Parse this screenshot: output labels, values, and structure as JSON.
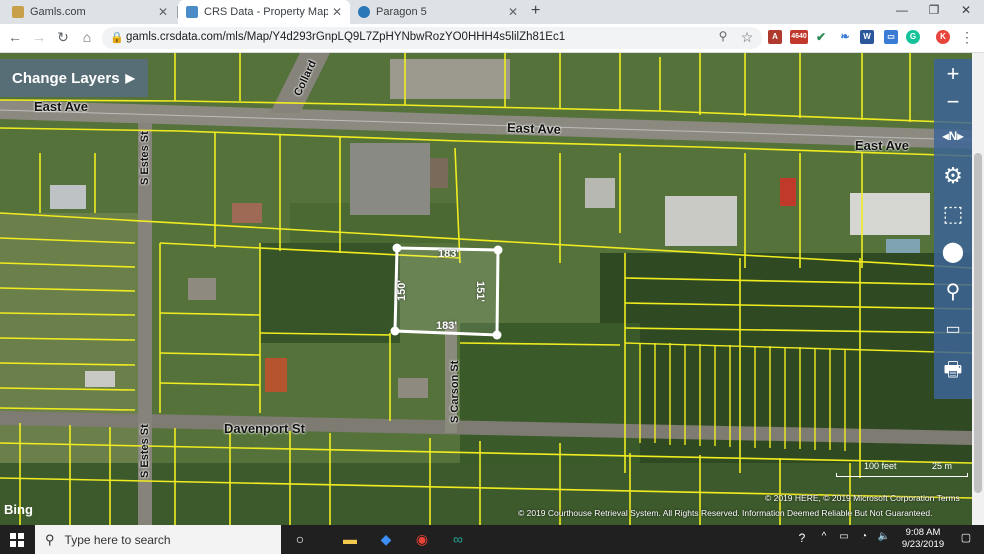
{
  "browser": {
    "tabs": [
      {
        "title": "Gamls.com",
        "active": false
      },
      {
        "title": "CRS Data - Property Map for Wel",
        "active": true
      },
      {
        "title": "Paragon 5",
        "active": false
      }
    ],
    "url": "gamls.crsdata.com/mls/Map/Y4d293rGnpLQ9L7ZpHYNbwRozYO0HHH4s5lilZh81Ec1",
    "extensions": [
      "4640",
      "W"
    ],
    "profile_initial": "K"
  },
  "map": {
    "change_layers_label": "Change Layers",
    "streets": {
      "east_ave_left": "East Ave",
      "east_ave_mid": "East Ave",
      "east_ave_right": "East Ave",
      "collard": "Collard",
      "s_estes_top": "S Estes St",
      "s_estes_bottom": "S Estes St",
      "s_carson": "S Carson St",
      "davenport": "Davenport St"
    },
    "parcel_dimensions": {
      "top": "183'",
      "bottom": "183'",
      "left": "150'",
      "right": "151'"
    },
    "tools": [
      "zoom-in",
      "zoom-out",
      "north",
      "settings",
      "select",
      "location",
      "search",
      "measure",
      "print"
    ],
    "scale": {
      "feet": "100 feet",
      "meters": "25 m"
    },
    "attribution_1": "© 2019 HERE, © 2019 Microsoft Corporation  Terms",
    "attribution_2": "© 2019 Courthouse Retrieval System. All Rights Reserved. Information Deemed Reliable But Not Guaranteed.",
    "bing_label": "Bing"
  },
  "taskbar": {
    "search_placeholder": "Type here to search",
    "time": "9:08 AM",
    "date": "9/23/2019"
  }
}
